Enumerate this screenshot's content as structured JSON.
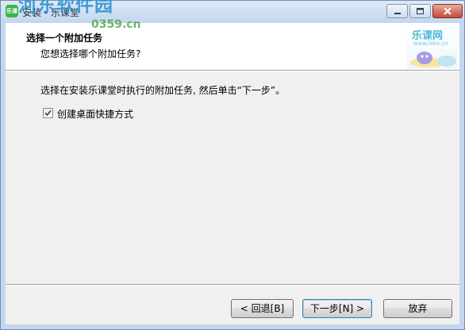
{
  "window": {
    "title": "安装 - 乐课堂",
    "app_icon_text": "乐课"
  },
  "header": {
    "title": "选择一个附加任务",
    "subtitle": "您想选择哪个附加任务?",
    "logo_text": "乐课网",
    "logo_url": "www.leke.cn"
  },
  "watermark": {
    "text": "河东软件园",
    "url": "0359.cn"
  },
  "body": {
    "instruction": "选择在安装乐课堂时执行的附加任务, 然后单击“下一步”。",
    "tasks": [
      {
        "label": "创建桌面快捷方式",
        "checked": true
      }
    ]
  },
  "buttons": {
    "back": "< 回退[B]",
    "next": "下一步[N] >",
    "cancel": "放弃"
  },
  "colors": {
    "window_frame": "#c4d7ef",
    "client_bg": "#f0f0f0",
    "close_button": "#c5473a",
    "default_button_border": "#3c7fb1"
  }
}
